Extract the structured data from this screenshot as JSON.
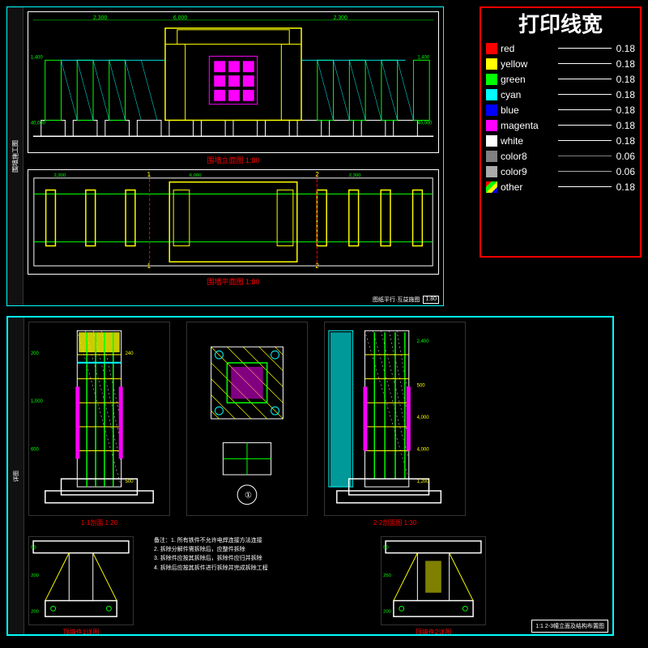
{
  "legend": {
    "title": "打印线宽",
    "items": [
      {
        "name": "red",
        "color": "#ff0000",
        "dash": "—",
        "value": "0.18",
        "type": "solid"
      },
      {
        "name": "yellow",
        "color": "#ffff00",
        "dash": "—",
        "value": "0.18",
        "type": "solid"
      },
      {
        "name": "green",
        "color": "#00ff00",
        "dash": "—",
        "value": "0.18",
        "type": "solid"
      },
      {
        "name": "cyan",
        "color": "#00ffff",
        "dash": "—",
        "value": "0.18",
        "type": "solid"
      },
      {
        "name": "blue",
        "color": "#0000ff",
        "dash": "—",
        "value": "0.18",
        "type": "solid"
      },
      {
        "name": "magenta",
        "color": "#ff00ff",
        "dash": "—",
        "value": "0.18",
        "type": "solid"
      },
      {
        "name": "white",
        "color": "#ffffff",
        "dash": "—",
        "value": "0.18",
        "type": "solid"
      },
      {
        "name": "color8",
        "color": "#808080",
        "dash": "—",
        "value": "0.06",
        "type": "solid"
      },
      {
        "name": "color9",
        "color": "#aaaaaa",
        "dash": "—",
        "value": "0.06",
        "type": "solid"
      },
      {
        "name": "other",
        "color": "multi",
        "dash": "—",
        "value": "0.18",
        "type": "multi"
      }
    ]
  },
  "top_panel": {
    "elevation_label": "围墙立面图 1:80",
    "plan_label": "围墙平面图 1:80",
    "footer_text": "图纸平行·互益施图"
  },
  "bottom_panel": {
    "section_left_label": "1-1剖面 1:20",
    "section_right_label": "2-2剖面图 1:30",
    "detail_left_label": "顶墙件1详图",
    "detail_right_label": "顶墙件2详图",
    "notes": [
      "备注：1. 所有铁件不允许电焊连接方法连接",
      "2. 拆除分解件需拆除后，应整件拆除",
      "3. 拆除件应按其拆除后，拆除件应归并拆除",
      "4. 拆除后应按其拆件进行拆除并完成拆除工程"
    ],
    "title_block": "1:1 2-3幢立面及结构布置图"
  }
}
